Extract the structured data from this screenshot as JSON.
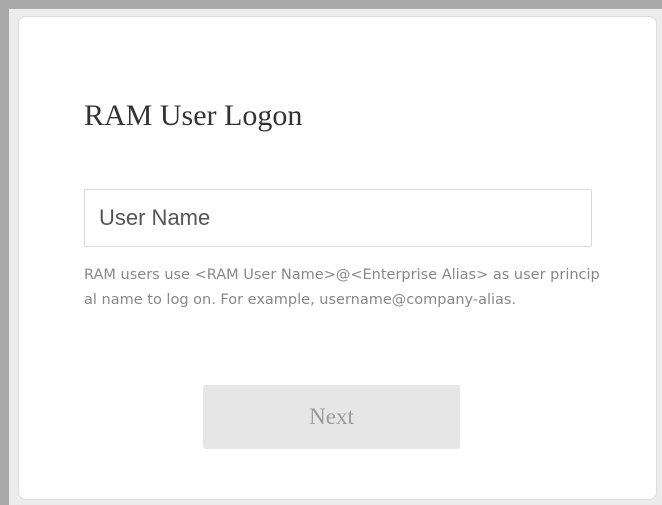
{
  "logon": {
    "title": "RAM User Logon",
    "username_placeholder": "User Name",
    "username_value": "",
    "hint": "RAM users use <RAM User Name>@<Enterprise Alias> as user principal name to log on. For example, username@company-alias.",
    "next_label": "Next",
    "next_enabled": false
  },
  "colors": {
    "card_background": "#ffffff",
    "button_background_disabled": "#e6e6e6",
    "button_text_disabled": "#9a9a9a",
    "hint_text": "#888888",
    "title_text": "#333333"
  }
}
